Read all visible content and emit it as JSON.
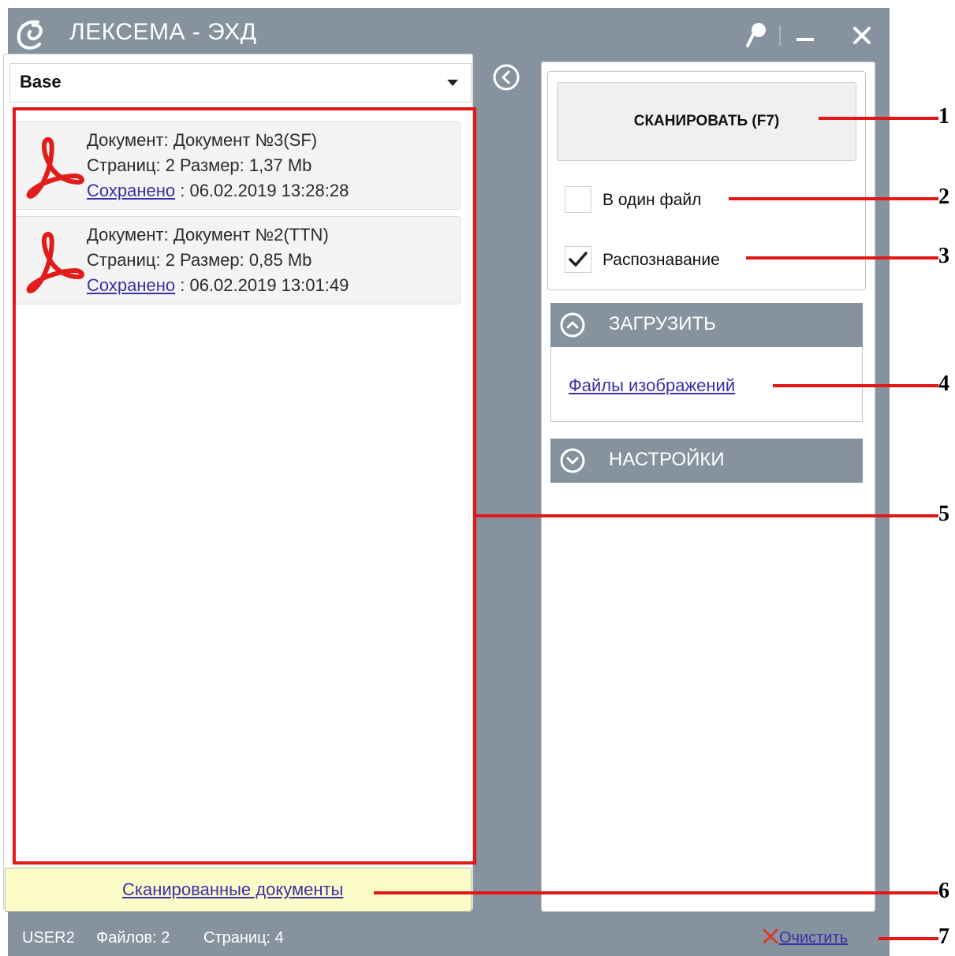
{
  "window": {
    "title": "ЛЕКСЕМА - ЭХД",
    "accent_color": "#86939f"
  },
  "left": {
    "database_select": "Base",
    "documents": [
      {
        "line1": "Документ: Документ №3(SF)",
        "line2": "Страниц: 2 Размер: 1,37 Mb",
        "saved_link": "Сохранено",
        "saved_time": " : 06.02.2019 13:28:28"
      },
      {
        "line1": "Документ: Документ №2(TTN)",
        "line2": "Страниц: 2 Размер: 0,85 Mb",
        "saved_link": "Сохранено",
        "saved_time": " : 06.02.2019 13:01:49"
      }
    ],
    "footer_link": "Сканированные документы"
  },
  "right": {
    "scan_button": "СКАНИРОВАТЬ (F7)",
    "one_file_label": "В один файл",
    "one_file_checked": false,
    "recognition_label": "Распознавание",
    "recognition_checked": true,
    "load_section_title": "ЗАГРУЗИТЬ",
    "image_files_link": "Файлы изображений",
    "settings_section_title": "НАСТРОЙКИ"
  },
  "status": {
    "user": "USER2",
    "files": "Файлов: 2",
    "pages": "Страниц: 4",
    "clear_link": "Очистить"
  },
  "callouts": [
    "1",
    "2",
    "3",
    "4",
    "5",
    "6",
    "7"
  ]
}
